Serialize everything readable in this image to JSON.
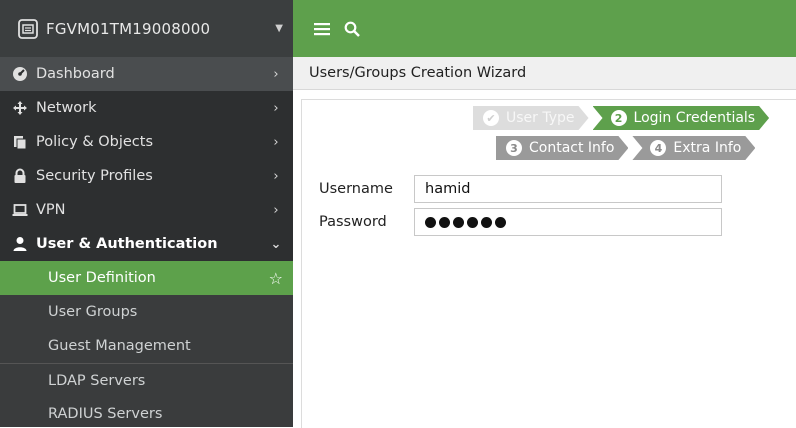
{
  "device": {
    "name": "FGVM01TM19008000"
  },
  "nav": {
    "items": [
      {
        "label": "Dashboard",
        "icon": "dashboard-icon"
      },
      {
        "label": "Network",
        "icon": "network-icon"
      },
      {
        "label": "Policy & Objects",
        "icon": "policy-icon"
      },
      {
        "label": "Security Profiles",
        "icon": "lock-icon"
      },
      {
        "label": "VPN",
        "icon": "vpn-laptop-icon"
      },
      {
        "label": "User & Authentication",
        "icon": "user-icon"
      }
    ],
    "sub_items": [
      {
        "label": "User Definition",
        "active": true
      },
      {
        "label": "User Groups"
      },
      {
        "label": "Guest Management"
      },
      {
        "label": "LDAP Servers"
      },
      {
        "label": "RADIUS Servers"
      }
    ]
  },
  "breadcrumb": {
    "title": "Users/Groups Creation Wizard"
  },
  "wizard": {
    "steps": [
      {
        "label": "User Type",
        "state": "done"
      },
      {
        "label": "Login Credentials",
        "number": "2",
        "state": "current"
      },
      {
        "label": "Contact Info",
        "number": "3",
        "state": "pending"
      },
      {
        "label": "Extra Info",
        "number": "4",
        "state": "pending"
      }
    ],
    "username_label": "Username",
    "username_value": "hamid",
    "password_label": "Password",
    "password_masked_count": 6
  },
  "colors": {
    "accent": "#5ea04c",
    "sidebar": "#2d2f30"
  }
}
